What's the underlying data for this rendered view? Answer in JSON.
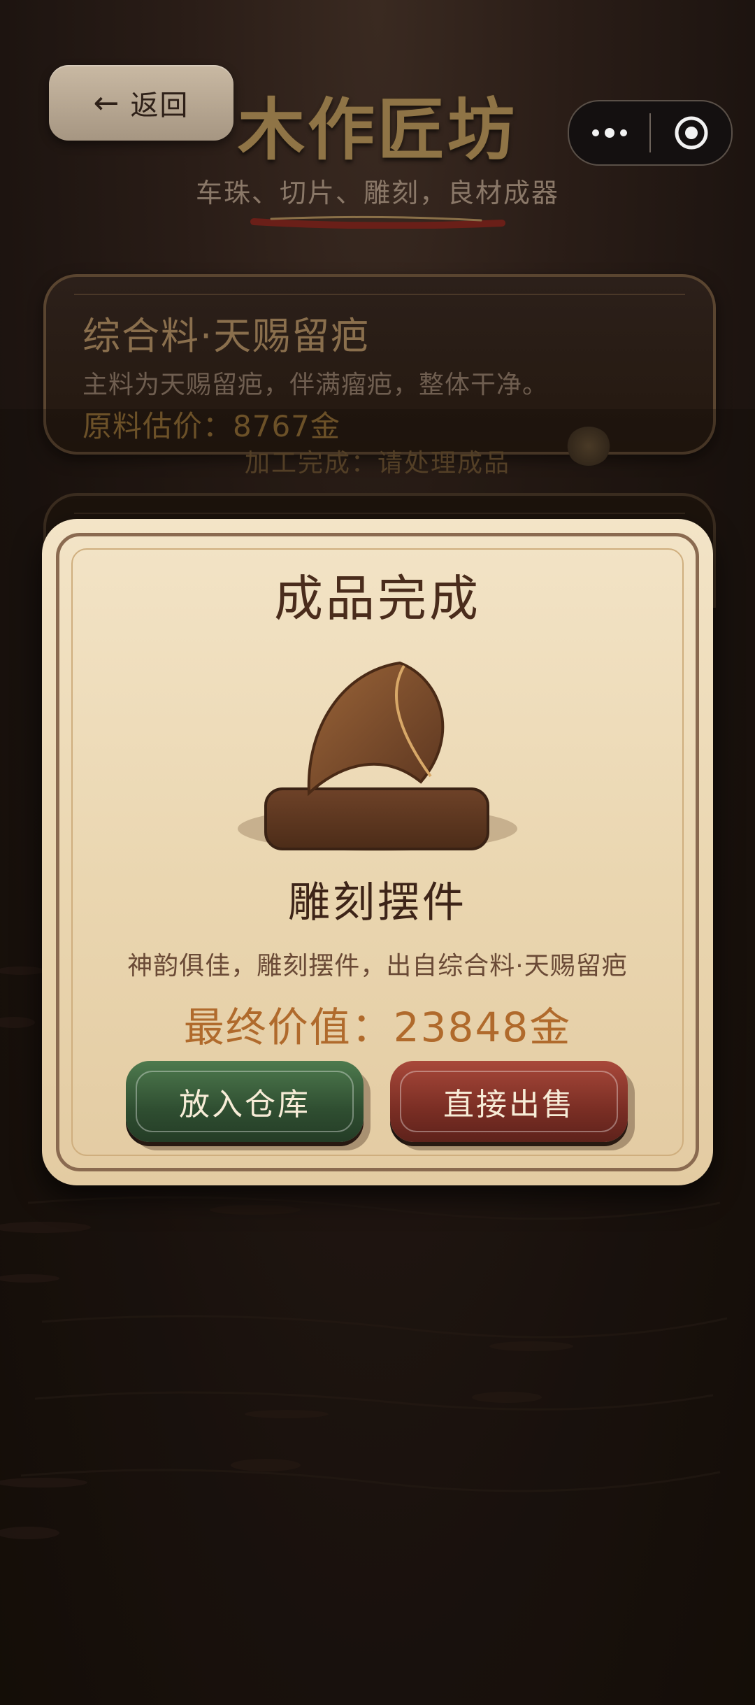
{
  "header": {
    "back_label": "返回",
    "title": "木作匠坊",
    "subtitle": "车珠、切片、雕刻，良材成器"
  },
  "icons": {
    "back": "arrow-left-icon",
    "more": "more-dots-icon",
    "close": "target-close-icon"
  },
  "material_card": {
    "title": "综合料·天赐留疤",
    "description": "主料为天赐留疤，伴满瘤疤，整体干净。",
    "price": "原料估价：8767金"
  },
  "status": {
    "text": "加工完成：请处理成品"
  },
  "modal": {
    "title": "成品完成",
    "product_name": "雕刻摆件",
    "product_desc": "神韵俱佳，雕刻摆件，出自综合料·天赐留疤",
    "final_value": "最终价值：23848金",
    "store_button": "放入仓库",
    "sell_button": "直接出售"
  },
  "colors": {
    "accent_gold": "#8f7446",
    "modal_bg": "#efdcbc",
    "value_orange": "#b06a2c",
    "store_green": "#3e6440",
    "sell_red": "#8a3a2e"
  }
}
